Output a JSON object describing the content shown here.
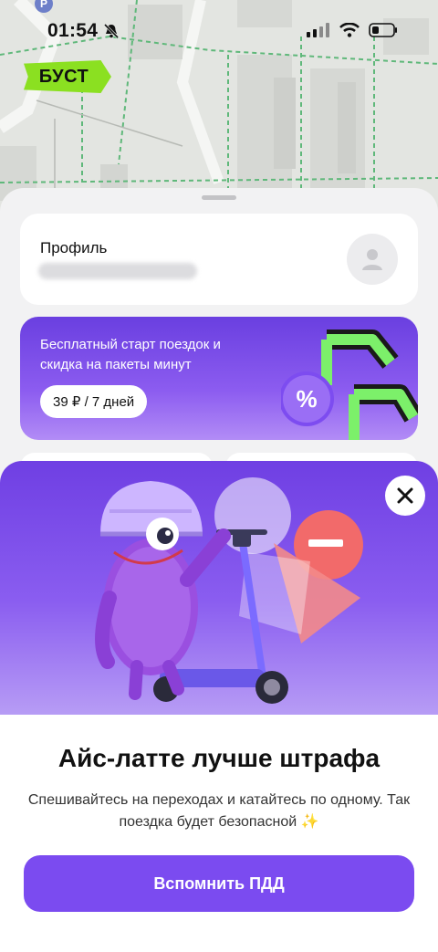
{
  "status_bar": {
    "time": "01:54"
  },
  "map": {
    "parking_label": "P"
  },
  "brand": {
    "label": "БУСТ",
    "color": "#8be021"
  },
  "profile": {
    "title": "Профиль"
  },
  "promo": {
    "text": "Бесплатный старт поездок и скидка на пакеты минут",
    "chip": "39 ₽ / 7 дней"
  },
  "modal": {
    "title": "Айс-латте лучше штрафа",
    "description": "Спешивайтесь на переходах и катайтесь по одному. Так поездка будет безопасной ✨",
    "button": "Вспомнить ПДД"
  },
  "colors": {
    "accent": "#7b4bf0",
    "hero_top": "#6f3fe3"
  }
}
